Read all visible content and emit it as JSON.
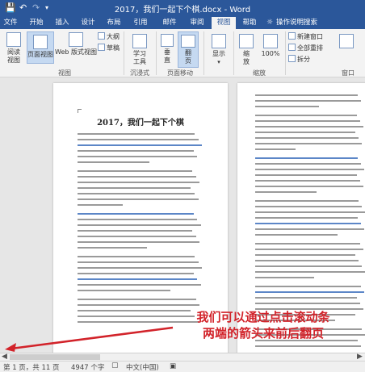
{
  "titlebar": {
    "title": "2017，我们一起下个棋.docx - Word",
    "save_icon": "save-icon",
    "undo_icon": "undo-icon",
    "redo_icon": "redo-icon",
    "customize_icon": "customize-quick-access-icon"
  },
  "tabs": [
    {
      "label": "文件"
    },
    {
      "label": "开始"
    },
    {
      "label": "插入"
    },
    {
      "label": "设计"
    },
    {
      "label": "布局"
    },
    {
      "label": "引用"
    },
    {
      "label": "邮件"
    },
    {
      "label": "审阅"
    },
    {
      "label": "视图"
    },
    {
      "label": "帮助"
    },
    {
      "label": "操作说明搜索"
    }
  ],
  "active_tab": "视图",
  "ribbon": {
    "views": {
      "read_mode": "阅读\n视图",
      "print_layout": "页面视图",
      "web_layout": "Web 版式视图",
      "outline": "大纲",
      "draft": "草稿",
      "group": "视图"
    },
    "immersive": {
      "learning_tools": "学习\n工具",
      "group": "沉浸式"
    },
    "page_movement": {
      "vertical": "垂\n直",
      "side_to_side": "翻\n页",
      "group": "页面移动"
    },
    "show": {
      "label": "显示"
    },
    "zoom": {
      "zoom": "缩\n放",
      "hundred": "100%",
      "group": "缩放"
    },
    "window": {
      "new_window": "新建窗口",
      "arrange_all": "全部重排",
      "split": "拆分",
      "group": "窗口"
    }
  },
  "document": {
    "page1_title": "2017，我们一起下个棋"
  },
  "annotation": {
    "line1": "我们可以通过点击滚动条",
    "line2": "两端的箭头来前后翻页"
  },
  "status": {
    "page": "第 1 页，共 11 页",
    "words": "4947 个字",
    "language": "中文(中国)"
  },
  "colors": {
    "brand": "#2b579a",
    "annotation": "#d2232a"
  }
}
